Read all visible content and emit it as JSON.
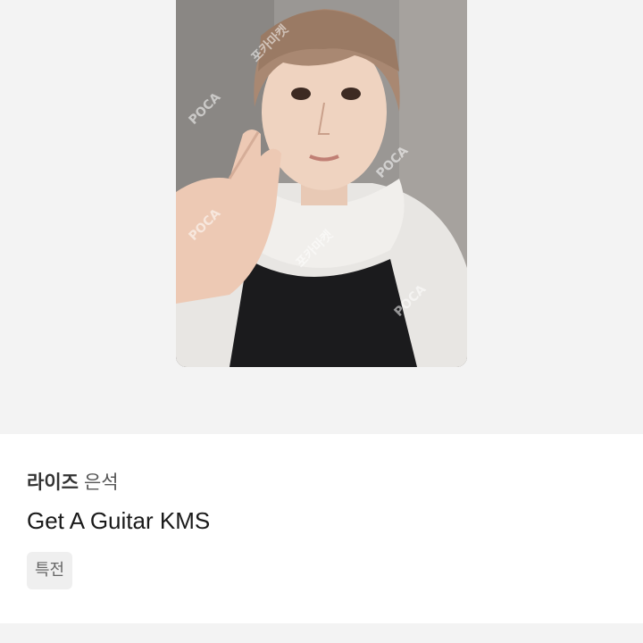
{
  "product": {
    "group": "라이즈",
    "member": "은석",
    "title": "Get A Guitar KMS",
    "tag": "특전"
  },
  "photocard": {
    "watermark_logo": "POCA",
    "watermark_sub": "포카마켓"
  },
  "colors": {
    "page_background": "#f3f3f3",
    "info_background": "#ffffff",
    "tag_background": "#efefef"
  }
}
